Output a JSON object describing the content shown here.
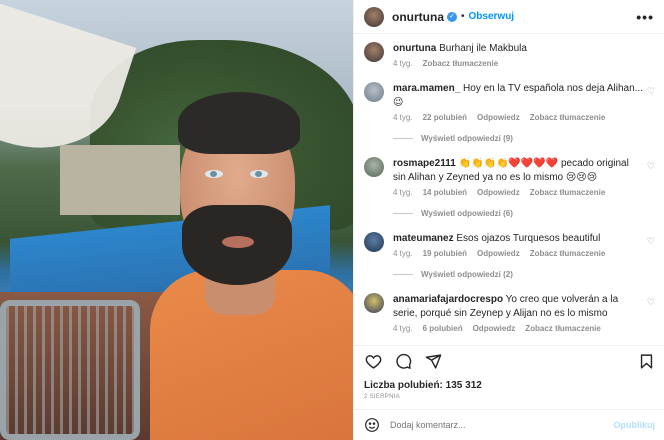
{
  "post": {
    "username": "onurtuna",
    "verified_mark": "✓",
    "follow_label": "Obserwuj",
    "dot": "•",
    "more": "•••"
  },
  "caption": {
    "username": "onurtuna",
    "text": "Burhanj ile Makbula",
    "age": "4 tyg.",
    "translate": "Zobacz tłumaczenie"
  },
  "comments": [
    {
      "username": "mara.mamen_",
      "text": "Hoy en la TV española nos deja Alihan...😉",
      "age": "4 tyg.",
      "likes": "22 polubień",
      "reply": "Odpowiedz",
      "translate": "Zobacz tłumaczenie",
      "replies": "Wyświetl odpowiedzi (9)"
    },
    {
      "username": "rosmape2111",
      "text": "👏👏👏👏❤️❤️❤️❤️ pecado original sin Alihan y Zeyned ya no es lo mismo 😢😢😢",
      "age": "4 tyg.",
      "likes": "14 polubień",
      "reply": "Odpowiedz",
      "translate": "Zobacz tłumaczenie",
      "replies": "Wyświetl odpowiedzi (6)"
    },
    {
      "username": "mateumanez",
      "text": "Esos ojazos Turquesos beautiful",
      "age": "4 tyg.",
      "likes": "19 polubień",
      "reply": "Odpowiedz",
      "translate": "Zobacz tłumaczenie",
      "replies": "Wyświetl odpowiedzi (2)"
    },
    {
      "username": "anamariafajardocrespo",
      "text": "Yo creo que volverán a la serie, porqué sin Zeynep y Alijan no es lo mismo",
      "age": "4 tyg.",
      "likes": "6 polubień",
      "reply": "Odpowiedz",
      "translate": "Zobacz tłumaczenie",
      "replies": ""
    }
  ],
  "likes_label": "Liczba polubień: 135 312",
  "date": "2 SIERPNIA",
  "add_comment": {
    "placeholder": "Dodaj komentarz...",
    "publish": "Opublikuj"
  },
  "icons": {
    "heart": "heart-icon",
    "comment": "comment-icon",
    "share": "share-icon",
    "save": "bookmark-icon",
    "emoji": "emoji-icon"
  }
}
